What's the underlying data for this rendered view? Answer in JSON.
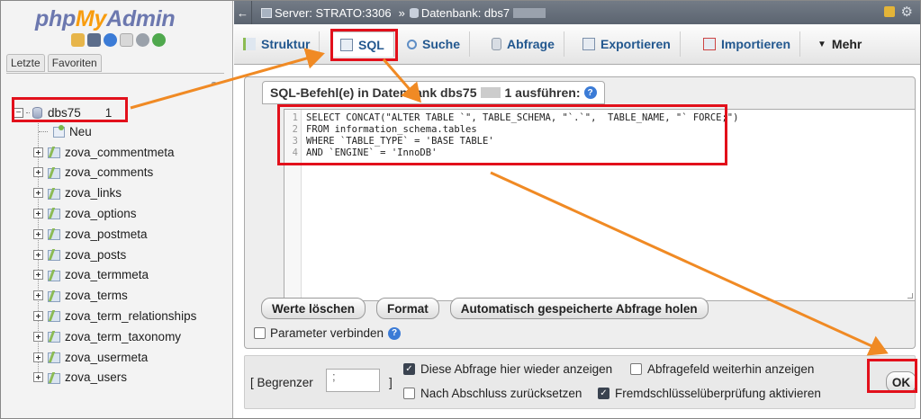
{
  "logo": {
    "php": "php",
    "my": "My",
    "admin": "Admin"
  },
  "nav": {
    "tabs": [
      "Letzte",
      "Favoriten"
    ],
    "database": "dbs75  1",
    "new_label": "Neu",
    "tables": [
      "zova_commentmeta",
      "zova_comments",
      "zova_links",
      "zova_options",
      "zova_postmeta",
      "zova_posts",
      "zova_termmeta",
      "zova_terms",
      "zova_term_relationships",
      "zova_term_taxonomy",
      "zova_usermeta",
      "zova_users"
    ]
  },
  "breadcrumb": {
    "server_label": "Server: STRATO:3306",
    "separator": "»",
    "db_label": "Datenbank: dbs7"
  },
  "menu": {
    "tabs": [
      {
        "label": "Struktur",
        "icon": "structure-icon"
      },
      {
        "label": "SQL",
        "icon": "sql-icon"
      },
      {
        "label": "Suche",
        "icon": "search-icon"
      },
      {
        "label": "Abfrage",
        "icon": "query-icon"
      },
      {
        "label": "Exportieren",
        "icon": "export-icon"
      },
      {
        "label": "Importieren",
        "icon": "import-icon"
      },
      {
        "label": "Mehr",
        "icon": "chevron-down-icon"
      }
    ],
    "active": "SQL"
  },
  "sql_panel": {
    "legend_prefix": "SQL-Befehl(e) in Datenbank dbs75",
    "legend_suffix": "1 ausführen:",
    "code_lines": [
      "SELECT CONCAT(\"ALTER TABLE `\", TABLE_SCHEMA, \"`.`\",  TABLE_NAME, \"` FORCE;\")",
      "FROM information_schema.tables",
      "WHERE `TABLE_TYPE` = 'BASE TABLE'",
      "AND `ENGINE` = 'InnoDB'"
    ],
    "buttons": {
      "clear": "Werte löschen",
      "format": "Format",
      "autosave": "Automatisch gespeicherte Abfrage holen"
    },
    "bind_params": "Parameter verbinden"
  },
  "bottom": {
    "delimiter_label": "[ Begrenzer",
    "delimiter_value": ";",
    "delimiter_close": "]",
    "show_query_again": {
      "label": "Diese Abfrage hier wieder anzeigen",
      "checked": true
    },
    "keep_query_box": {
      "label": "Abfragefeld weiterhin anzeigen",
      "checked": false
    },
    "rollback_on_finish": {
      "label": "Nach Abschluss zurücksetzen",
      "checked": false
    },
    "fk_checks": {
      "label": "Fremdschlüsselüberprüfung aktivieren",
      "checked": true
    },
    "ok_label": "OK"
  },
  "colors": {
    "annotation_red": "#e2101b",
    "annotation_arrow": "#f08a24",
    "link_blue": "#23588f"
  }
}
